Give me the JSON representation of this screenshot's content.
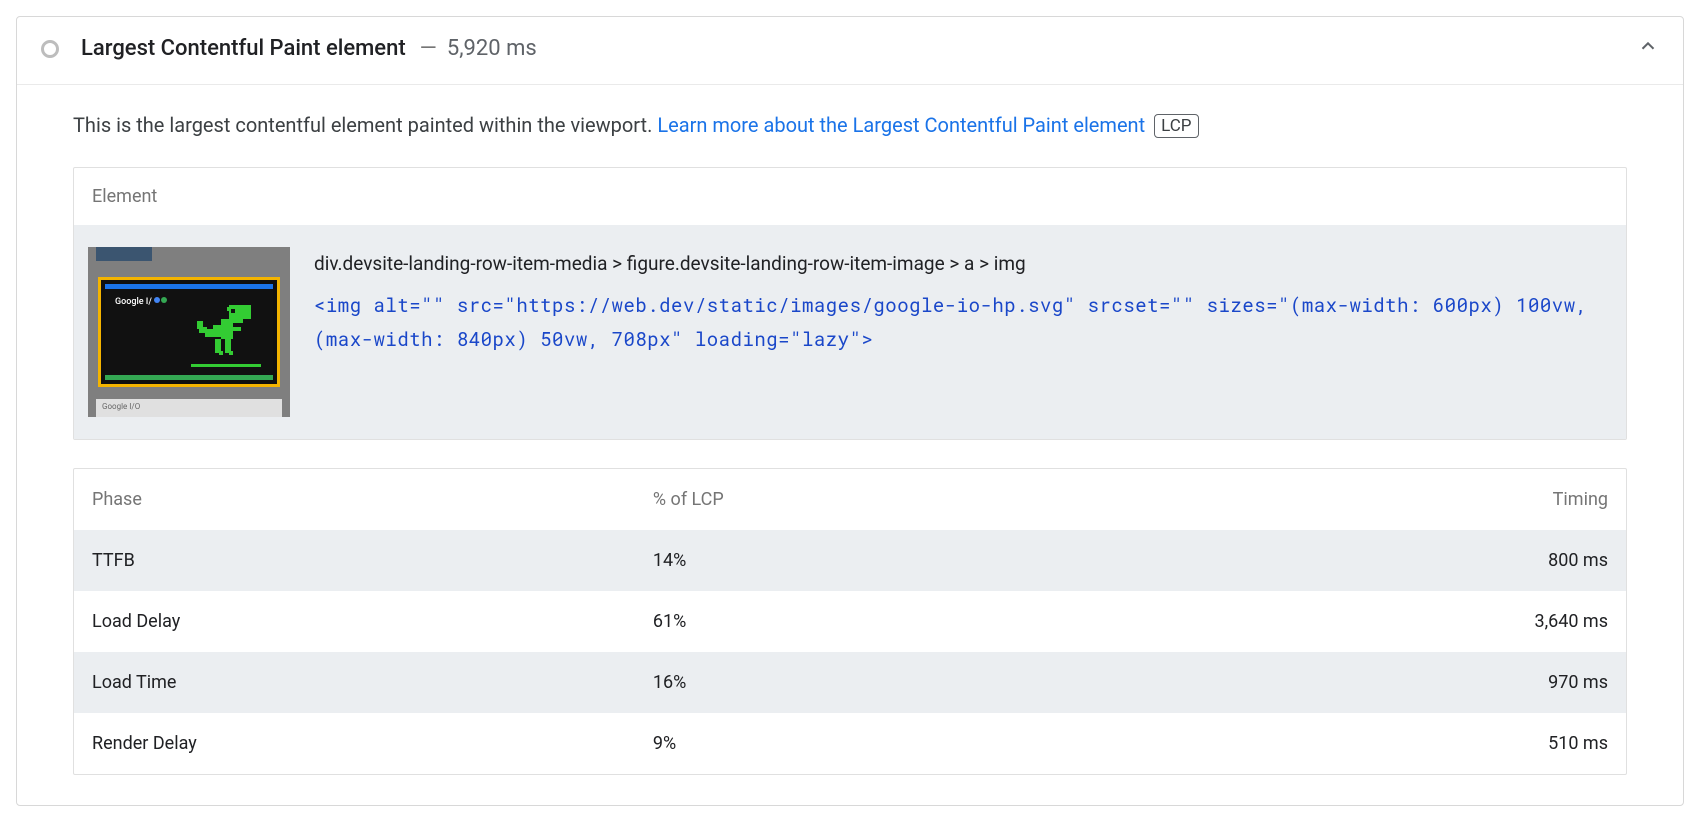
{
  "header": {
    "title": "Largest Contentful Paint element",
    "separator": "—",
    "value": "5,920 ms"
  },
  "description": {
    "text": "This is the largest contentful element painted within the viewport. ",
    "link": "Learn more about the Largest Contentful Paint element",
    "badge": "LCP"
  },
  "element": {
    "header": "Element",
    "selector": "div.devsite-landing-row-item-media > figure.devsite-landing-row-item-image > a > img",
    "code": "<img alt=\"\" src=\"https://web.dev/static/images/google-io-hp.svg\" srcset=\"\" sizes=\"(max-width: 600px) 100vw, (max-width: 840px) 50vw, 708px\" loading=\"lazy\">",
    "thumb_logo": "Google I/",
    "thumb_footer": "Google I/O"
  },
  "table": {
    "columns": {
      "phase": "Phase",
      "pct": "% of LCP",
      "time": "Timing"
    },
    "rows": [
      {
        "phase": "TTFB",
        "pct": "14%",
        "time": "800 ms"
      },
      {
        "phase": "Load Delay",
        "pct": "61%",
        "time": "3,640 ms"
      },
      {
        "phase": "Load Time",
        "pct": "16%",
        "time": "970 ms"
      },
      {
        "phase": "Render Delay",
        "pct": "9%",
        "time": "510 ms"
      }
    ]
  }
}
